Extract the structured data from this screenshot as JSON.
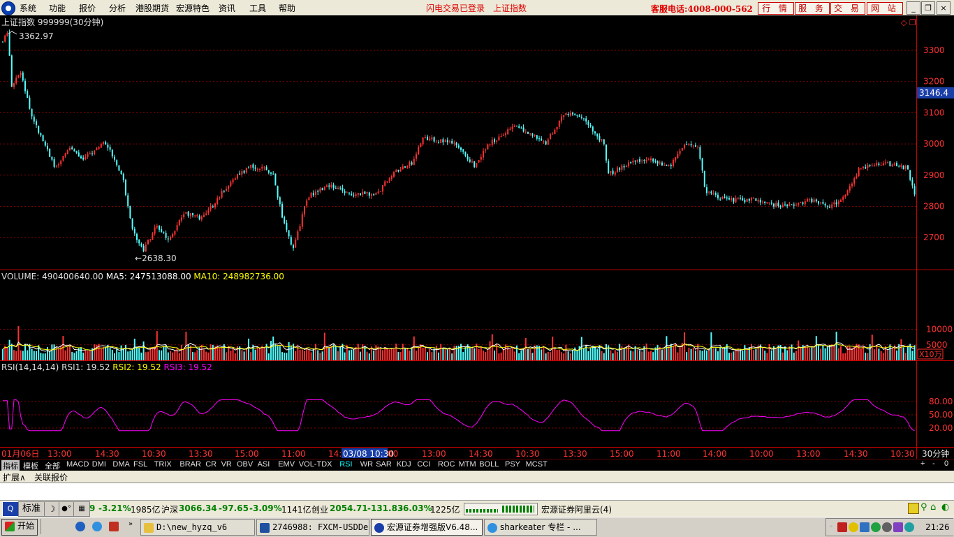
{
  "menubar": {
    "items": [
      "系统",
      "功能",
      "报价",
      "分析",
      "港股期货",
      "宏源特色",
      "资讯",
      "工具",
      "帮助"
    ],
    "alerts": [
      "闪电交易已登录",
      "上证指数"
    ],
    "hotline": "客服电话:4008-000-562",
    "buttons": [
      "行 情",
      "服 务",
      "交 易",
      "网 站"
    ],
    "window_buttons": [
      "_",
      "❐",
      "×"
    ]
  },
  "chart": {
    "title": "上证指数 999999(30分钟)",
    "high_label": "3362.97",
    "low_label": "2638.30",
    "current_price_tag": "3146.4",
    "price_ticks": [
      "3300",
      "3200",
      "3100",
      "3000",
      "2900",
      "2800",
      "2700"
    ]
  },
  "volume": {
    "prefix": "VOLUME: 490400640.00",
    "ma5": "MA5: 247513088.00",
    "ma10": "MA10: 248982736.00",
    "ticks": [
      "10000",
      "5000"
    ],
    "unit_tag": "X10万"
  },
  "rsi": {
    "prefix": "RSI(14,14,14)",
    "rsi1": "RSI1: 19.52",
    "rsi2": "RSI2: 19.52",
    "rsi3": "RSI3: 19.52",
    "ticks": [
      "80.00",
      "50.00",
      "20.00"
    ]
  },
  "time_axis": {
    "labels": [
      "01月06日",
      "13:00",
      "14:30",
      "10:30",
      "13:30",
      "15:00",
      "11:00",
      "14:",
      "13:00",
      "14:30",
      "10:30",
      "13:30",
      "15:00",
      "11:00",
      "14:00",
      "10:00",
      "13:00",
      "14:30",
      "10:30"
    ],
    "cursor_label": "03/08 10:30",
    "cursor_suffix": "00",
    "period": "30分钟"
  },
  "tabs": [
    "指标",
    "模板",
    "全部",
    "MACD",
    "DMI",
    "DMA",
    "FSL",
    "TRIX",
    "BRAR",
    "CR",
    "VR",
    "OBV",
    "ASI",
    "EMV",
    "VOL-TDX",
    "RSI",
    "WR",
    "SAR",
    "KDJ",
    "CCI",
    "ROC",
    "MTM",
    "BOLL",
    "PSY",
    "MCST"
  ],
  "active_tab": "RSI",
  "tab_controls": [
    "+",
    "-",
    "0"
  ],
  "ext_tabs": [
    "扩展∧",
    "关联报价"
  ],
  "statusbar": {
    "mode": "标准",
    "frag_change": "-3.21%",
    "frag_amount": "1985亿",
    "hs_label": "沪深",
    "hs_value": "3066.34",
    "hs_change": "-97.65",
    "hs_pct": "-3.09%",
    "hs_amount": "1141亿",
    "cy_label": "创业",
    "cy_value": "2054.71",
    "cy_change": "-131.83",
    "cy_pct": "-6.03%",
    "cy_amount": "1225亿",
    "server": "宏源证券阿里云(4)"
  },
  "taskbar": {
    "start": "开始",
    "tasks": [
      "D:\\new_hyzq_v6",
      "2746988: FXCM-USDDe...",
      "宏源证券增强版V6.48...",
      "sharkeater 专栏 - ..."
    ],
    "clock": "21:26"
  },
  "colors": {
    "up": "#ff3232",
    "down": "#54ffff",
    "ma5": "#ffffff",
    "ma10": "#ffff00",
    "rsi": "#ff00ff",
    "grid": "#8b0000",
    "axis": "#c80000"
  }
}
